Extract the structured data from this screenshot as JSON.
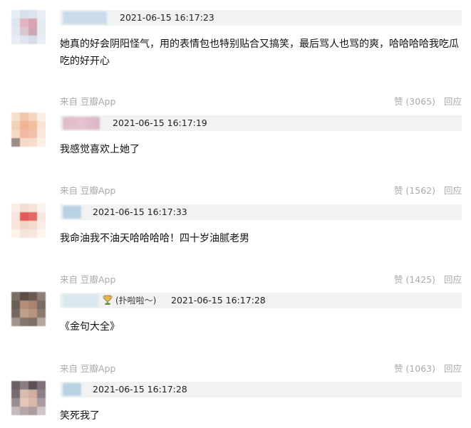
{
  "comments": [
    {
      "timestamp": "2021-06-15 16:17:23",
      "text": "她真的好会阴阳怪气，用的表情包也特别贴合又搞笑，最后骂人也骂的爽，哈哈哈哈我吃瓜吃的好开心",
      "source": "",
      "like_label": "",
      "reply_label": ""
    },
    {
      "timestamp": "2021-06-15 16:17:19",
      "text": "我感觉喜欢上她了",
      "source": "来自 豆瓣App",
      "like_label": "赞 (3065)",
      "reply_label": "回应"
    },
    {
      "timestamp": "2021-06-15 16:17:33",
      "text": "我命油我不油天哈哈哈哈！四十岁油腻老男",
      "source": "来自 豆瓣App",
      "like_label": "赞 (1562)",
      "reply_label": "回应"
    },
    {
      "timestamp": "2021-06-15 16:17:28",
      "badge": "(扑啦啦～)",
      "text": "《金句大全》",
      "source": "来自 豆瓣App",
      "like_label": "赞 (1425)",
      "reply_label": "回应"
    },
    {
      "timestamp": "2021-06-15 16:17:28",
      "text": "笑死我了",
      "source": "来自 豆瓣App",
      "like_label": "赞 (1063)",
      "reply_label": "回应"
    }
  ]
}
